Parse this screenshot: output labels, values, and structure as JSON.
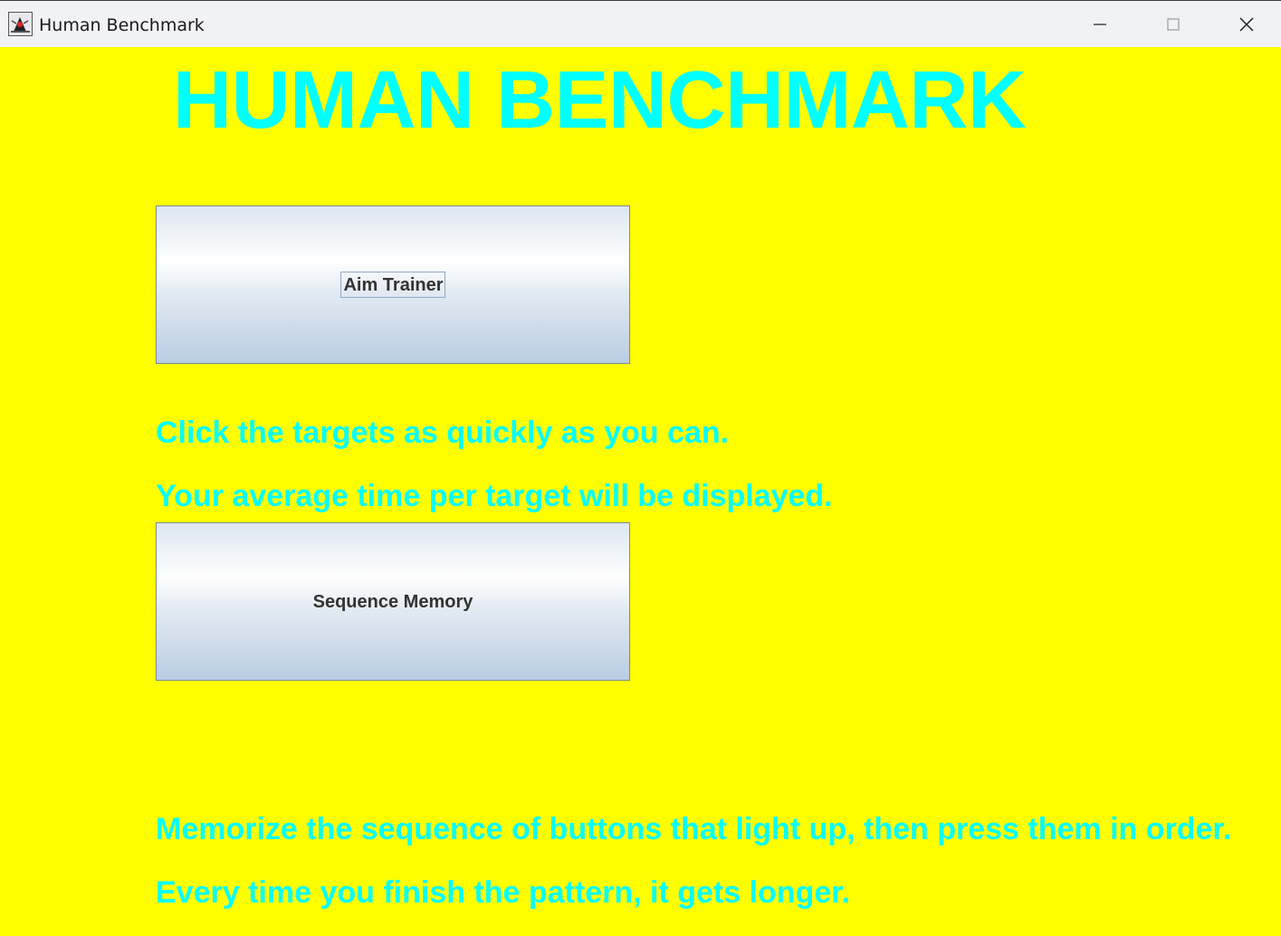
{
  "window": {
    "title": "Human Benchmark",
    "icon": "java-duke-icon",
    "controls": [
      "minimize-icon",
      "maximize-icon",
      "close-icon"
    ]
  },
  "main": {
    "heading": "HUMAN BENCHMARK",
    "aim_trainer": {
      "button_label": "Aim Trainer",
      "description": [
        "Click the targets as quickly as you can.",
        "Your average time per target will be displayed."
      ]
    },
    "sequence_memory": {
      "button_label": "Sequence Memory",
      "description": [
        "Memorize the sequence of buttons that light up, then press them in order.",
        "Every time you finish the pattern, it gets longer."
      ]
    }
  },
  "colors": {
    "background": "#ffff00",
    "text_accent": "#00ffff",
    "button_text": "#333333"
  }
}
